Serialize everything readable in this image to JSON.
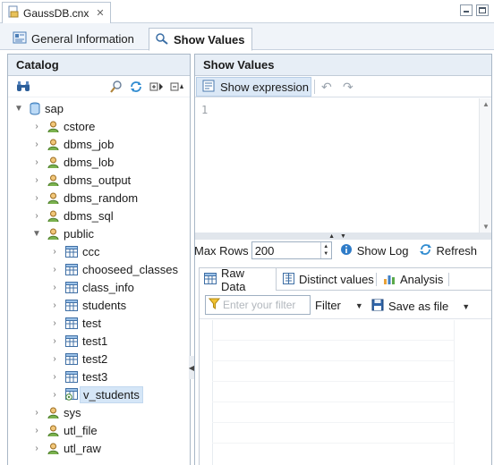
{
  "editor_tab": {
    "title": "GaussDB.cnx",
    "close": "✕"
  },
  "view_tabs": [
    {
      "label": "General Information",
      "icon": "general-info-icon"
    },
    {
      "label": "Show Values",
      "icon": "show-values-icon"
    }
  ],
  "catalog": {
    "title": "Catalog",
    "toolbar_icons": [
      "binoculars-icon",
      "search-icon",
      "sync-icon",
      "expand-all-icon",
      "collapse-all-icon"
    ],
    "tree": [
      {
        "label": "sap",
        "type": "database",
        "expanded": true,
        "level": 0
      },
      {
        "label": "cstore",
        "type": "schema",
        "expanded": false,
        "level": 1
      },
      {
        "label": "dbms_job",
        "type": "schema",
        "expanded": false,
        "level": 1
      },
      {
        "label": "dbms_lob",
        "type": "schema",
        "expanded": false,
        "level": 1
      },
      {
        "label": "dbms_output",
        "type": "schema",
        "expanded": false,
        "level": 1
      },
      {
        "label": "dbms_random",
        "type": "schema",
        "expanded": false,
        "level": 1
      },
      {
        "label": "dbms_sql",
        "type": "schema",
        "expanded": false,
        "level": 1
      },
      {
        "label": "public",
        "type": "schema",
        "expanded": true,
        "level": 1
      },
      {
        "label": "ccc",
        "type": "table",
        "expanded": false,
        "level": 2
      },
      {
        "label": "chooseed_classes",
        "type": "table",
        "expanded": false,
        "level": 2
      },
      {
        "label": "class_info",
        "type": "table",
        "expanded": false,
        "level": 2
      },
      {
        "label": "students",
        "type": "table",
        "expanded": false,
        "level": 2
      },
      {
        "label": "test",
        "type": "table",
        "expanded": false,
        "level": 2
      },
      {
        "label": "test1",
        "type": "table",
        "expanded": false,
        "level": 2
      },
      {
        "label": "test2",
        "type": "table",
        "expanded": false,
        "level": 2
      },
      {
        "label": "test3",
        "type": "table",
        "expanded": false,
        "level": 2
      },
      {
        "label": "v_students",
        "type": "view",
        "expanded": false,
        "level": 2,
        "selected": true
      },
      {
        "label": "sys",
        "type": "schema",
        "expanded": false,
        "level": 1
      },
      {
        "label": "utl_file",
        "type": "schema",
        "expanded": false,
        "level": 1
      },
      {
        "label": "utl_raw",
        "type": "schema",
        "expanded": false,
        "level": 1
      }
    ]
  },
  "show_values": {
    "title": "Show Values",
    "show_expression_label": "Show expression",
    "editor_line_number": "1",
    "max_rows_label": "Max Rows",
    "max_rows_value": "200",
    "show_log_label": "Show Log",
    "refresh_label": "Refresh",
    "result_tabs": [
      {
        "label": "Raw Data",
        "icon": "grid-icon"
      },
      {
        "label": "Distinct values",
        "icon": "distinct-icon"
      },
      {
        "label": "Analysis",
        "icon": "bar-chart-icon"
      }
    ],
    "filter_placeholder": "Enter your filter",
    "filter_label": "Filter",
    "save_as_label": "Save as file"
  },
  "colors": {
    "accent": "#dbe8f6",
    "panel_header": "#e7eef6",
    "border": "#a9b7c6",
    "selection": "#d5e6f7"
  }
}
